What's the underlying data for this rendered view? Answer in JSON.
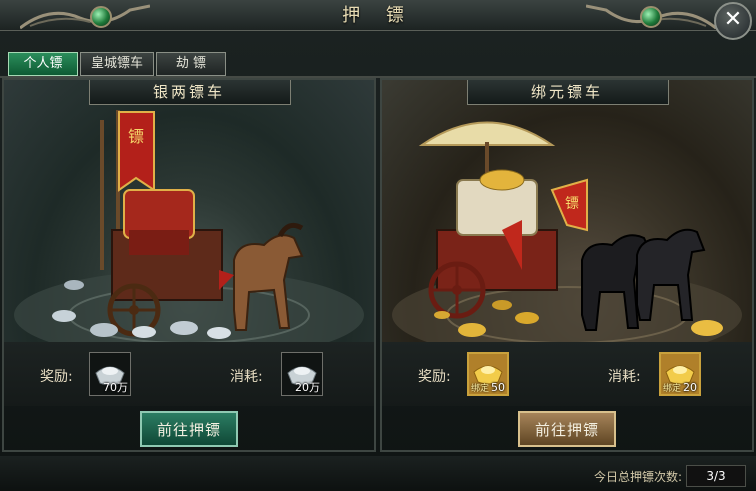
{
  "window": {
    "title": "押 镖",
    "close_label": "✕"
  },
  "tabs": [
    {
      "label": "个人镖",
      "active": true
    },
    {
      "label": "皇城镖车",
      "active": false
    },
    {
      "label": "劫 镖",
      "active": false
    }
  ],
  "carts": [
    {
      "name": "银两镖车",
      "reward_label": "奖励:",
      "reward_item": {
        "icon": "silver-ingot-icon",
        "count": "70万"
      },
      "cost_label": "消耗:",
      "cost_item": {
        "icon": "silver-ingot-icon",
        "count": "20万"
      },
      "button_label": "前往押镖"
    },
    {
      "name": "绑元镖车",
      "reward_label": "奖励:",
      "reward_item": {
        "icon": "gold-ingot-icon",
        "bind_tag": "绑定",
        "count": "50"
      },
      "cost_label": "消耗:",
      "cost_item": {
        "icon": "gold-ingot-icon",
        "bind_tag": "绑定",
        "count": "20"
      },
      "button_label": "前往押镖"
    }
  ],
  "footer": {
    "label": "今日总押镖次数:",
    "value": "3/3"
  },
  "colors": {
    "accent_green": "#0e5a33",
    "accent_gold": "#c9a13c"
  }
}
